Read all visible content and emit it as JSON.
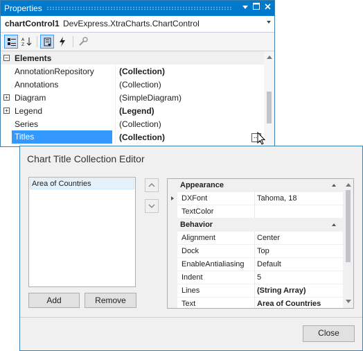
{
  "properties": {
    "title": "Properties",
    "object_name": "chartControl1",
    "object_type": "DevExpress.XtraCharts.ChartControl",
    "category": "Elements",
    "rows": [
      {
        "name": "AnnotationRepository",
        "value": "(Collection)",
        "bold": true,
        "expandable": false
      },
      {
        "name": "Annotations",
        "value": "(Collection)",
        "bold": false,
        "expandable": false
      },
      {
        "name": "Diagram",
        "value": "(SimpleDiagram)",
        "bold": false,
        "expandable": true
      },
      {
        "name": "Legend",
        "value": "(Legend)",
        "bold": true,
        "expandable": true
      },
      {
        "name": "Series",
        "value": "(Collection)",
        "bold": false,
        "expandable": false
      },
      {
        "name": "Titles",
        "value": "(Collection)",
        "bold": true,
        "expandable": false,
        "selected": true
      }
    ],
    "ellipsis": "..."
  },
  "editor": {
    "title": "Chart Title Collection Editor",
    "list_items": [
      "Area of Countries"
    ],
    "add_label": "Add",
    "remove_label": "Remove",
    "close_label": "Close",
    "categories": [
      {
        "name": "Appearance",
        "rows": [
          {
            "name": "DXFont",
            "value": "Tahoma, 18",
            "expandable": true
          },
          {
            "name": "TextColor",
            "value": ""
          }
        ]
      },
      {
        "name": "Behavior",
        "rows": [
          {
            "name": "Alignment",
            "value": "Center"
          },
          {
            "name": "Dock",
            "value": "Top"
          },
          {
            "name": "EnableAntialiasing",
            "value": "Default"
          },
          {
            "name": "Indent",
            "value": "5"
          },
          {
            "name": "Lines",
            "value": "(String Array)",
            "bold": true
          },
          {
            "name": "Text",
            "value": "Area of Countries",
            "bold": true
          }
        ]
      }
    ]
  },
  "colors": {
    "title_bar": "#007acc",
    "selection": "#3399ff",
    "window_border": "#3c7fb1"
  }
}
